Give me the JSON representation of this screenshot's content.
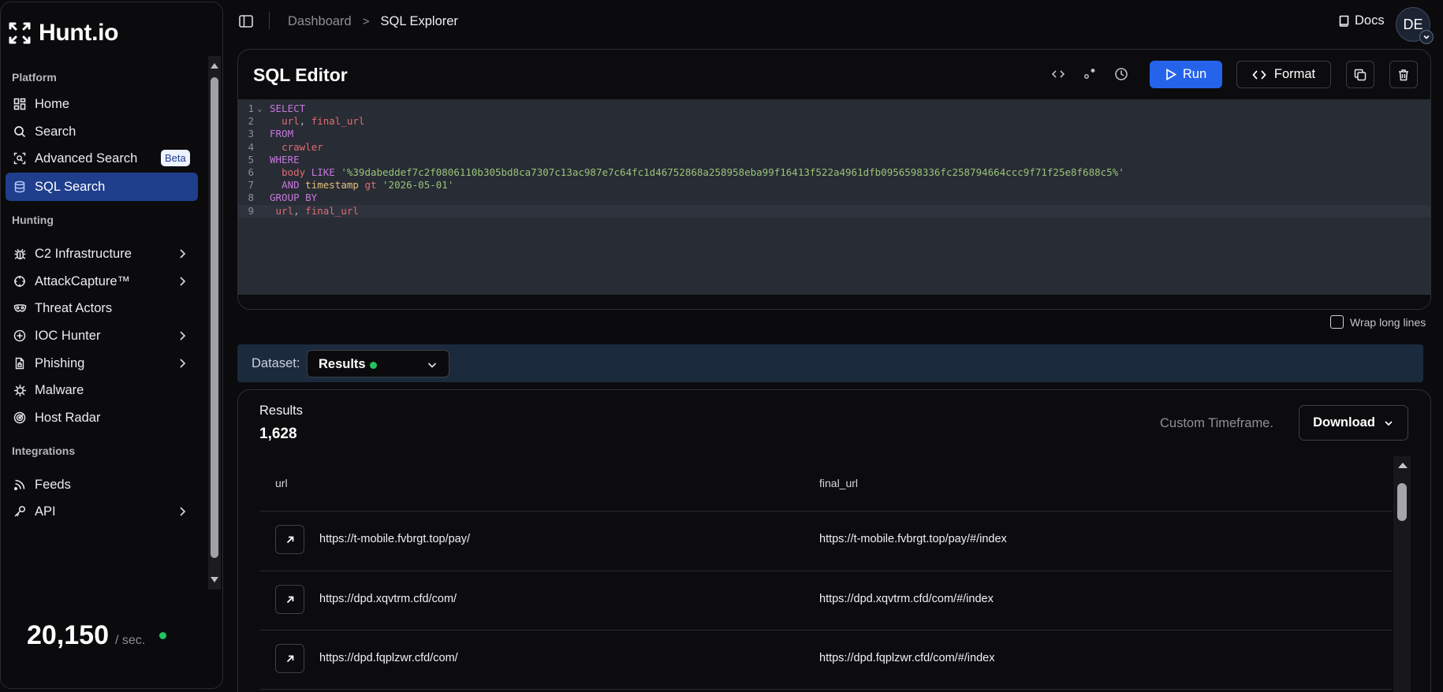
{
  "sidebar": {
    "logo_text": "Hunt.io",
    "sections": {
      "platform": "Platform",
      "hunting": "Hunting",
      "integrations": "Integrations"
    },
    "items": {
      "home": "Home",
      "search": "Search",
      "advanced_search": "Advanced Search",
      "advanced_badge": "Beta",
      "sql_search": "SQL Search",
      "c2": "C2 Infrastructure",
      "attackcapture": "AttackCapture™",
      "threat_actors": "Threat Actors",
      "ioc_hunter": "IOC Hunter",
      "phishing": "Phishing",
      "malware": "Malware",
      "host_radar": "Host Radar",
      "feeds": "Feeds",
      "api": "API"
    },
    "rate_value": "20,150",
    "rate_unit": "/ sec.",
    "accent_color": "#1f3e8c"
  },
  "topbar": {
    "breadcrumb_parent": "Dashboard",
    "breadcrumb_sep": ">",
    "breadcrumb_current": "SQL Explorer",
    "docs_label": "Docs",
    "avatar_initials": "DE"
  },
  "editor": {
    "title": "SQL Editor",
    "run_label": "Run",
    "format_label": "Format",
    "lines": [
      {
        "n": "1",
        "fold": "⌄",
        "parts": [
          [
            "kw",
            "SELECT"
          ]
        ]
      },
      {
        "n": "2",
        "parts": [
          [
            "op",
            "  "
          ],
          [
            "id",
            "url"
          ],
          [
            "op",
            ", "
          ],
          [
            "id",
            "final_url"
          ]
        ]
      },
      {
        "n": "3",
        "parts": [
          [
            "kw",
            "FROM"
          ]
        ]
      },
      {
        "n": "4",
        "parts": [
          [
            "op",
            "  "
          ],
          [
            "id",
            "crawler"
          ]
        ]
      },
      {
        "n": "5",
        "parts": [
          [
            "kw",
            "WHERE"
          ]
        ]
      },
      {
        "n": "6",
        "parts": [
          [
            "op",
            "  "
          ],
          [
            "id",
            "body"
          ],
          [
            "op",
            " "
          ],
          [
            "kw",
            "LIKE"
          ],
          [
            "op",
            " "
          ],
          [
            "str",
            "'%39dabeddef7c2f0806110b305bd8ca7307c13ac987e7c64fc1d46752868a258958eba99f16413f522a4961dfb0956598336fc258794664ccc9f71f25e8f688c5%'"
          ]
        ]
      },
      {
        "n": "7",
        "parts": [
          [
            "op",
            "  "
          ],
          [
            "kw",
            "AND"
          ],
          [
            "op",
            " "
          ],
          [
            "fn",
            "timestamp"
          ],
          [
            "op",
            " "
          ],
          [
            "id",
            "gt"
          ],
          [
            "op",
            " "
          ],
          [
            "str",
            "'2026-05-01'"
          ]
        ]
      },
      {
        "n": "8",
        "parts": [
          [
            "kw",
            "GROUP BY"
          ]
        ]
      },
      {
        "n": "9",
        "active": true,
        "parts": [
          [
            "op",
            " "
          ],
          [
            "id",
            "url"
          ],
          [
            "op",
            ", "
          ],
          [
            "id",
            "final_url"
          ]
        ]
      }
    ]
  },
  "wrap_label": "Wrap long lines",
  "dataset": {
    "label": "Dataset:",
    "selected": "Results"
  },
  "results": {
    "title": "Results",
    "count": "1,628",
    "timeframe": "Custom Timeframe.",
    "download_label": "Download",
    "columns": [
      "url",
      "final_url"
    ],
    "rows": [
      {
        "url": "https://t-mobile.fvbrgt.top/pay/",
        "final_url": "https://t-mobile.fvbrgt.top/pay/#/index"
      },
      {
        "url": "https://dpd.xqvtrm.cfd/com/",
        "final_url": "https://dpd.xqvtrm.cfd/com/#/index"
      },
      {
        "url": "https://dpd.fqplzwr.cfd/com/",
        "final_url": "https://dpd.fqplzwr.cfd/com/#/index"
      }
    ]
  }
}
